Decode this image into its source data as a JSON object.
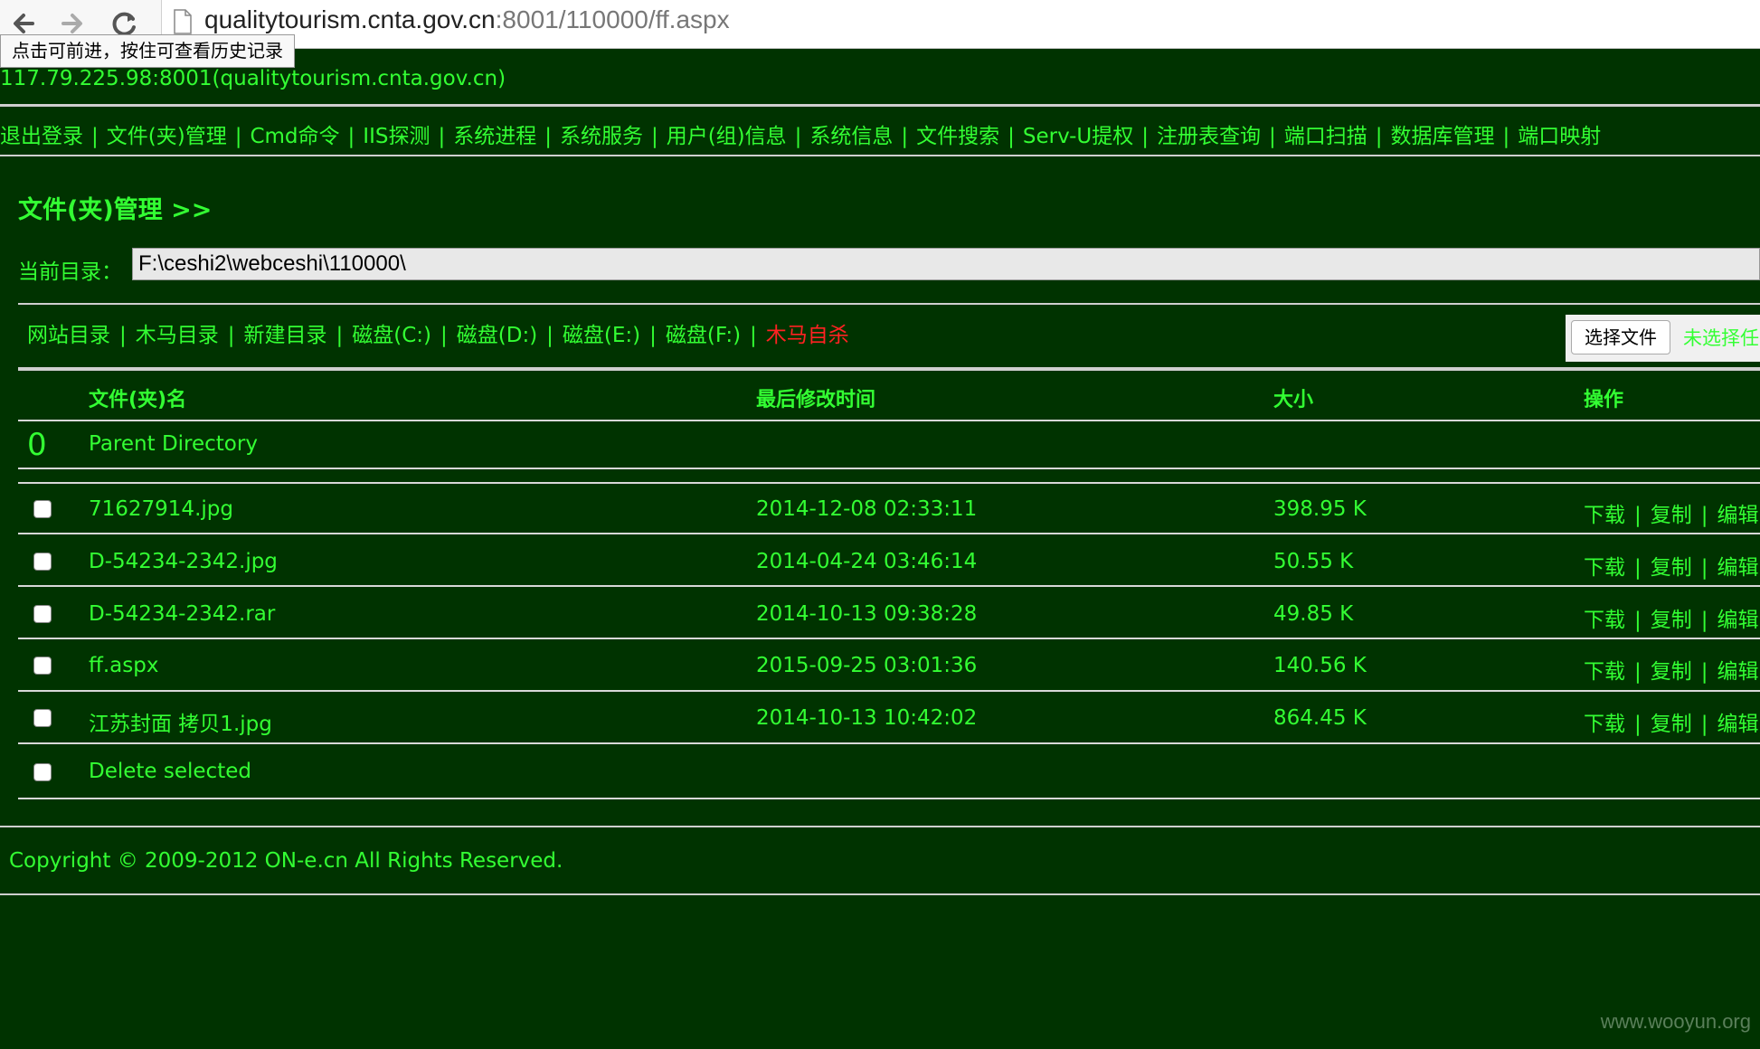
{
  "browser": {
    "url_host": "qualitytourism.cnta.gov.cn",
    "url_rest": ":8001/110000/ff.aspx",
    "tooltip": "点击可前进，按住可查看历史记录"
  },
  "host_line": "117.79.225.98:8001(qualitytourism.cnta.gov.cn)",
  "menu": [
    "退出登录",
    "文件(夹)管理",
    "Cmd命令",
    "IIS探测",
    "系统进程",
    "系统服务",
    "用户(组)信息",
    "系统信息",
    "文件搜索",
    "Serv-U提权",
    "注册表查询",
    "端口扫描",
    "数据库管理",
    "端口映射"
  ],
  "section_title": "文件(夹)管理 >>",
  "current_dir_label": "当前目录：",
  "current_dir": "F:\\ceshi2\\webceshi\\110000\\",
  "quick_links": [
    {
      "label": "网站目录"
    },
    {
      "label": "木马目录"
    },
    {
      "label": "新建目录"
    },
    {
      "label": "磁盘(C:)"
    },
    {
      "label": "磁盘(D:)"
    },
    {
      "label": "磁盘(E:)"
    },
    {
      "label": "磁盘(F:)"
    },
    {
      "label": "木马自杀",
      "danger": true
    }
  ],
  "upload": {
    "button": "选择文件",
    "status": "未选择任"
  },
  "table": {
    "headers": {
      "name": "文件(夹)名",
      "modified": "最后修改时间",
      "size": "大小",
      "action": "操作"
    },
    "parent": {
      "num": "0",
      "label": "Parent Directory"
    },
    "rows": [
      {
        "name": "71627914.jpg",
        "modified": "2014-12-08 02:33:11",
        "size": "398.95 K"
      },
      {
        "name": "D-54234-2342.jpg",
        "modified": "2014-04-24 03:46:14",
        "size": "50.55 K"
      },
      {
        "name": "D-54234-2342.rar",
        "modified": "2014-10-13 09:38:28",
        "size": "49.85 K"
      },
      {
        "name": "ff.aspx",
        "modified": "2015-09-25 03:01:36",
        "size": "140.56 K"
      },
      {
        "name": "江苏封面 拷贝1.jpg",
        "modified": "2014-10-13 10:42:02",
        "size": "864.45 K"
      }
    ],
    "actions": [
      "下载",
      "复制",
      "编辑"
    ],
    "delete_label": "Delete selected"
  },
  "footer": "Copyright © 2009-2012 ON-e.cn All Rights Reserved.",
  "watermark": "www.wooyun.org",
  "colors": {
    "background": "#003300",
    "text": "#33ff33",
    "danger": "#ff2222"
  }
}
